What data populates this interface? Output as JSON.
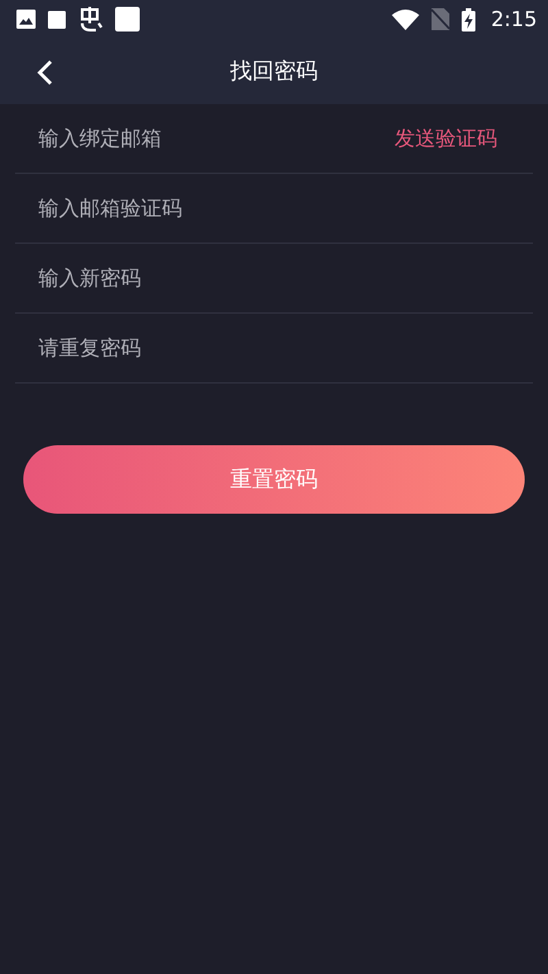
{
  "status_bar": {
    "time": "2:15"
  },
  "header": {
    "title": "找回密码"
  },
  "fields": [
    {
      "placeholder": "输入绑定邮箱",
      "action": "发送验证码"
    },
    {
      "placeholder": "输入邮箱验证码"
    },
    {
      "placeholder": "输入新密码"
    },
    {
      "placeholder": "请重复密码"
    }
  ],
  "submit": {
    "label": "重置密码"
  }
}
